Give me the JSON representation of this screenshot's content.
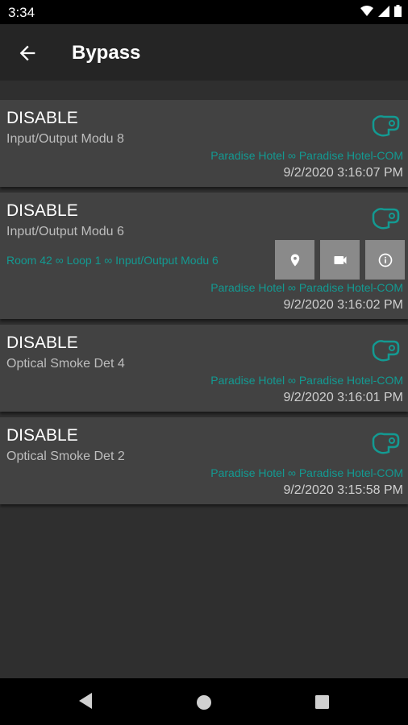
{
  "status_bar": {
    "time": "3:34"
  },
  "app_bar": {
    "title": "Bypass"
  },
  "items": [
    {
      "status": "DISABLE",
      "device": "Input/Output Modu 8",
      "site": "Paradise Hotel",
      "site_panel": "Paradise Hotel-COM",
      "timestamp": "9/2/2020 3:16:07 PM"
    },
    {
      "status": "DISABLE",
      "device": "Input/Output Modu 6",
      "location_room": "Room 42",
      "location_loop": "Loop 1",
      "location_device": "Input/Output Modu 6",
      "site": "Paradise Hotel",
      "site_panel": "Paradise Hotel-COM",
      "timestamp": "9/2/2020 3:16:02 PM",
      "actions": [
        "location-pin-icon",
        "video-camera-icon",
        "info-icon"
      ]
    },
    {
      "status": "DISABLE",
      "device": "Optical Smoke Det 4",
      "site": "Paradise Hotel",
      "site_panel": "Paradise Hotel-COM",
      "timestamp": "9/2/2020 3:16:01 PM"
    },
    {
      "status": "DISABLE",
      "device": "Optical Smoke Det 2",
      "site": "Paradise Hotel",
      "site_panel": "Paradise Hotel-COM",
      "timestamp": "9/2/2020 3:15:58 PM"
    }
  ],
  "colors": {
    "accent": "#139a92",
    "card": "#424242",
    "background": "#2f2f2f"
  }
}
